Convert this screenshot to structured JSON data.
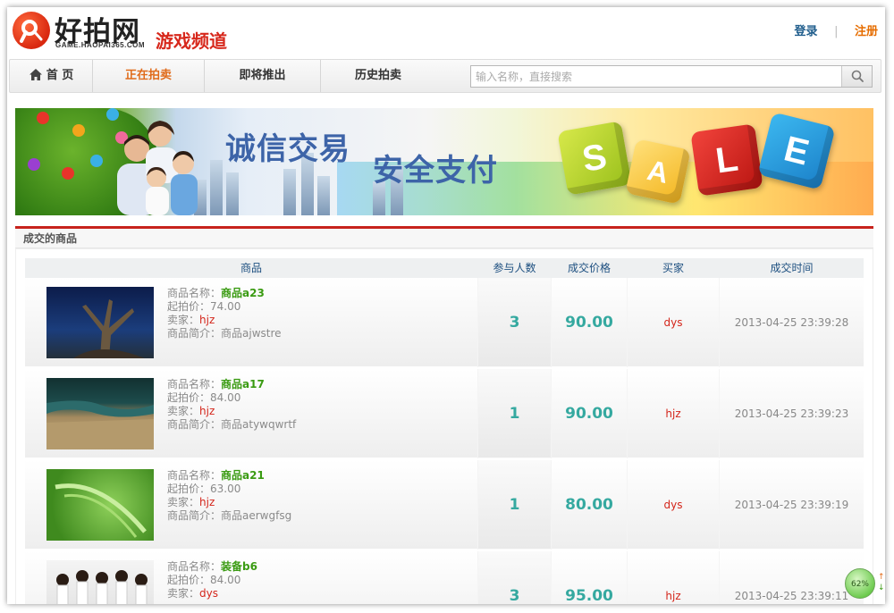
{
  "header": {
    "logo_main": "好拍网",
    "logo_domain": "GAME.HAOPAI365.COM",
    "logo_channel": "游戏频道",
    "login": "登录",
    "separator": "|",
    "register": "注册"
  },
  "nav": {
    "items": [
      {
        "label": "首 页",
        "active": false
      },
      {
        "label": "正在拍卖",
        "active": true
      },
      {
        "label": "即将推出",
        "active": false
      },
      {
        "label": "历史拍卖",
        "active": false
      }
    ],
    "search_placeholder": "输入名称，直接搜索"
  },
  "banner": {
    "text1": "诚信交易",
    "text2": "安全支付",
    "cubes": [
      "S",
      "A",
      "L",
      "E"
    ]
  },
  "section": {
    "title": "成交的商品"
  },
  "table": {
    "headers": {
      "product": "商品",
      "participants": "参与人数",
      "deal_price": "成交价格",
      "buyer": "买家",
      "deal_time": "成交时间"
    },
    "labels": {
      "name": "商品名称：",
      "start_price": "起拍价：",
      "seller": "卖家：",
      "intro": "商品简介："
    },
    "rows": [
      {
        "name": "商品a23",
        "start_price": "74.00",
        "seller": "hjz",
        "intro": "商品ajwstre",
        "participants": "3",
        "deal_price": "90.00",
        "buyer": "dys",
        "deal_time": "2013-04-25 23:39:28"
      },
      {
        "name": "商品a17",
        "start_price": "84.00",
        "seller": "hjz",
        "intro": "商品atywqwrtf",
        "participants": "1",
        "deal_price": "90.00",
        "buyer": "hjz",
        "deal_time": "2013-04-25 23:39:23"
      },
      {
        "name": "商品a21",
        "start_price": "63.00",
        "seller": "hjz",
        "intro": "商品aerwgfsg",
        "participants": "1",
        "deal_price": "80.00",
        "buyer": "dys",
        "deal_time": "2013-04-25 23:39:19"
      },
      {
        "name": "装备b6",
        "start_price": "84.00",
        "seller": "dys",
        "intro": "",
        "participants": "3",
        "deal_price": "95.00",
        "buyer": "hjz",
        "deal_time": "2013-04-25 23:39:11"
      }
    ]
  },
  "widget": {
    "percent": "62%"
  },
  "colors": {
    "brand_red": "#c7231d",
    "nav_active": "#e06b1a",
    "price_teal": "#35a9a0",
    "name_green": "#3a9b12"
  }
}
